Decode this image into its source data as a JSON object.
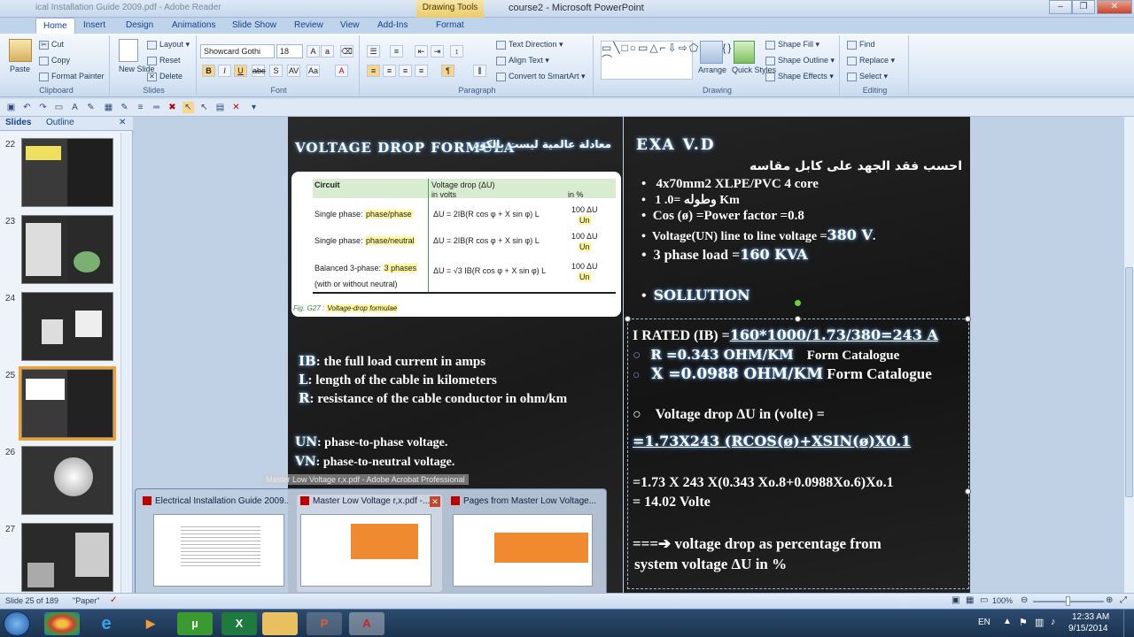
{
  "window": {
    "context_tab": "Drawing Tools",
    "title": "course2 - Microsoft PowerPoint",
    "ghost_title": "ical Installation Guide 2009.pdf - Adobe Reader"
  },
  "tabs": [
    "Home",
    "Insert",
    "Design",
    "Animations",
    "Slide Show",
    "Review",
    "View",
    "Add-Ins",
    "Format"
  ],
  "ribbon": {
    "clipboard": {
      "label": "Clipboard",
      "paste": "Paste",
      "cut": "Cut",
      "copy": "Copy",
      "format_painter": "Format Painter"
    },
    "slides": {
      "label": "Slides",
      "new_slide": "New Slide",
      "layout": "Layout",
      "reset": "Reset",
      "delete": "Delete"
    },
    "font": {
      "label": "Font",
      "family": "Showcard Gothi",
      "size": "18"
    },
    "paragraph": {
      "label": "Paragraph",
      "text_direction": "Text Direction",
      "align_text": "Align Text",
      "convert": "Convert to SmartArt"
    },
    "drawing": {
      "label": "Drawing",
      "arrange": "Arrange",
      "quick_styles": "Quick Styles",
      "shape_fill": "Shape Fill",
      "shape_outline": "Shape Outline",
      "shape_effects": "Shape Effects"
    },
    "editing": {
      "label": "Editing",
      "find": "Find",
      "replace": "Replace",
      "select": "Select"
    }
  },
  "panel": {
    "tab_slides": "Slides",
    "tab_outline": "Outline",
    "thumb_numbers": [
      "22",
      "23",
      "24",
      "25",
      "26",
      "27"
    ]
  },
  "slide": {
    "left_title": "VOLTAGE DROP FORMULA",
    "left_title_ar": "معادلة عالمية ليست بالكود",
    "table": {
      "h_circuit": "Circuit",
      "h_vd": "Voltage drop (ΔU)",
      "h_volts": "in volts",
      "h_pct": "in %",
      "rows": [
        {
          "label": "Single phase: ",
          "hl": "phase/phase",
          "formula": "ΔU = 2IB(R cos φ + X sin φ) L",
          "pct_top": "100 ΔU",
          "pct_bot": "Un"
        },
        {
          "label": "Single phase: ",
          "hl": "phase/neutral",
          "formula": "ΔU = 2IB(R cos φ + X sin φ) L",
          "pct_top": "100 ΔU",
          "pct_bot": "Un"
        },
        {
          "label": "Balanced 3-phase: ",
          "hl": "3 phases",
          "label2": "(with or without neutral)",
          "formula": "ΔU = √3 IB(R cos φ + X sin φ) L",
          "pct_top": "100 ΔU",
          "pct_bot": "Un"
        }
      ],
      "fig_prefix": "Fig. G27 : ",
      "fig_caption": "Voltage-drop formulae"
    },
    "defs": [
      {
        "k": "IB",
        "v": ": the full load current in amps"
      },
      {
        "k": "L",
        "v": ": length of the cable in kilometers"
      },
      {
        "k": "R",
        "v": ": resistance of the cable conductor in ohm/km"
      }
    ],
    "defs2": [
      {
        "k": "UN",
        "v": ": phase-to-phase voltage."
      },
      {
        "k": "VN",
        "v": ": phase-to-neutral voltage."
      }
    ],
    "right_title": "EXA V.D",
    "right_ar": "احسب فقد الجهد على كابل مقاسه",
    "bullets": [
      "4x70mm2  XLPE/PVC 4 core",
      "وطوله =0. 1 Km",
      "Cos (ø) =Power factor =0.8"
    ],
    "voltage_label": "Voltage(UN) line to line voltage =",
    "voltage_val": "380 V",
    "load_label": "3 phase load =",
    "load_val": "160 KVA",
    "solution": "SOLLUTION",
    "irated_label": "I RATED (IB) =",
    "irated_val": "160*1000/1.73/380=243 A",
    "r_val": "R =0.343 OHM/KM",
    "r_src": "Form Catalogue",
    "x_val": "X =0.0988  OHM/KM",
    "x_src": "Form Catalogue",
    "vd_label": "Voltage drop   ΔU  in (volte) =",
    "vd_formula": "=1.73X243 (RCOS(ø)+XSIN(ø)X0.1",
    "calc_line": "=1.73 X 243 X(0.343 Xo.8+0.0988Xo.6)Xo.1",
    "calc_result": "=  14.02 Volte",
    "pct_line1": "===➔ voltage drop as percentage from",
    "pct_line2": "system voltage ΔU  in %"
  },
  "preview": {
    "tooltip": "Master Low Voltage r,x.pdf - Adobe Acrobat Professional",
    "items": [
      "Electrical Installation Guide 2009...",
      "Master Low Voltage r,x.pdf -...",
      "Pages from Master Low Voltage..."
    ]
  },
  "status": {
    "slide": "Slide 25 of 189",
    "theme": "\"Paper\"",
    "lang": "English (United States)",
    "zoom": "100%"
  },
  "taskbar": {
    "lang": "EN",
    "time": "12:33 AM",
    "date": "9/15/2014"
  }
}
